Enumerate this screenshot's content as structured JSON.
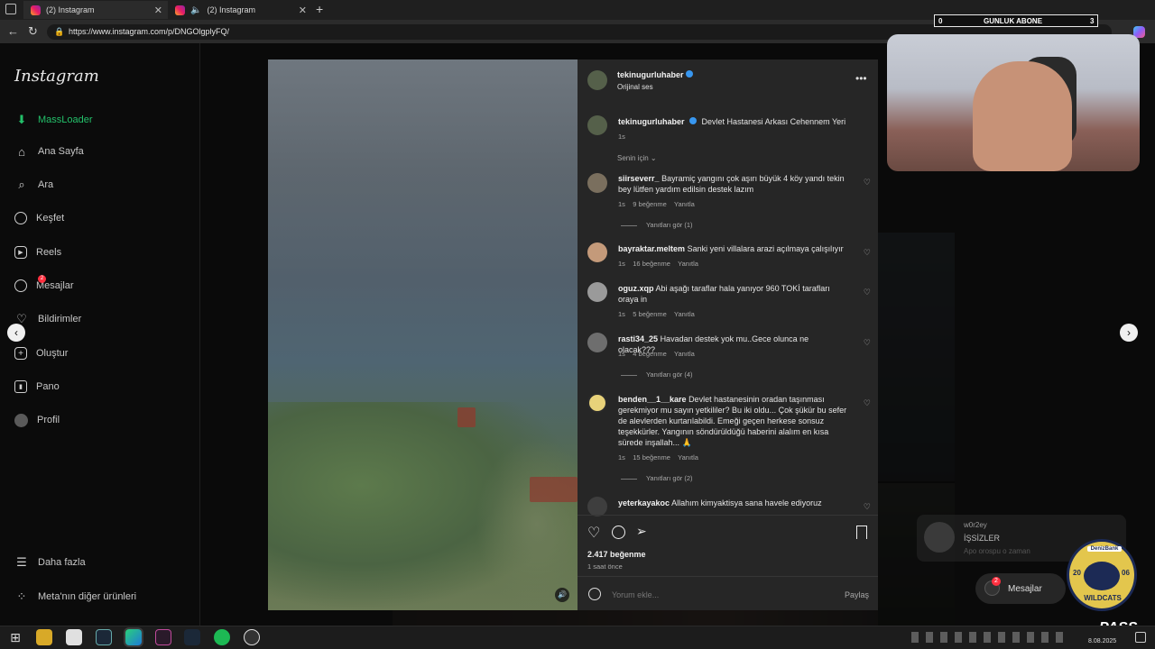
{
  "browser": {
    "tabs": [
      {
        "title": "(2) Instagram"
      },
      {
        "title": "(2) Instagram"
      }
    ],
    "new_tab": "+",
    "url": "https://www.instagram.com/p/DNGOlgplyFQ/"
  },
  "sidebar": {
    "logo": "Instagram",
    "items": [
      {
        "label": "MassLoader"
      },
      {
        "label": "Ana Sayfa"
      },
      {
        "label": "Ara"
      },
      {
        "label": "Keşfet"
      },
      {
        "label": "Reels"
      },
      {
        "label": "Mesajlar",
        "badge": "2"
      },
      {
        "label": "Bildirimler"
      },
      {
        "label": "Oluştur"
      },
      {
        "label": "Pano"
      },
      {
        "label": "Profil"
      }
    ],
    "more": "Daha fazla",
    "meta": "Meta'nın diğer ürünleri"
  },
  "post": {
    "author": "tekinugurluhaber",
    "audio": "Orijinal ses",
    "caption_author": "tekinugurluhaber",
    "caption": "Devlet Hastanesi Arkası Cehennem Yeri",
    "caption_time": "1s",
    "sort_label": "Senin için",
    "likes": "2.417 beğenme",
    "posted": "1 saat önce",
    "comment_placeholder": "Yorum ekle...",
    "share": "Paylaş"
  },
  "comments": [
    {
      "user": "siirseverr_",
      "text": "Bayramiç yangını çok aşırı büyük 4 köy yandı tekin bey lütfen yardım edilsin destek lazım",
      "time": "1s",
      "likes": "9 beğenme",
      "reply": "Yanıtla",
      "replies": "Yanıtları gör (1)"
    },
    {
      "user": "bayraktar.meltem",
      "text": "Sanki yeni villalara arazi açılmaya çalışılıyır",
      "time": "1s",
      "likes": "16 beğenme",
      "reply": "Yanıtla",
      "replies": ""
    },
    {
      "user": "oguz.xqp",
      "text": "Abi aşağı taraflar hala yanıyor 960 TOKİ tarafları oraya in",
      "time": "1s",
      "likes": "5 beğenme",
      "reply": "Yanıtla",
      "replies": ""
    },
    {
      "user": "rasti34_25",
      "text": "Havadan destek yok mu..Gece olunca ne olacak???",
      "time": "1s",
      "likes": "4 beğenme",
      "reply": "Yanıtla",
      "replies": "Yanıtları gör (4)"
    },
    {
      "user": "benden__1__kare",
      "text": "Devlet hastanesinin oradan taşınması gerekmiyor mu sayın yetkililer? Bu iki oldu... Çok şükür bu sefer de alevlerden kurtarılabildi. Emeği geçen herkese sonsuz teşekkürler. Yangının söndürüldüğü haberini alalım en kısa sürede inşallah... 🙏",
      "time": "1s",
      "likes": "15 beğenme",
      "reply": "Yanıtla",
      "replies": "Yanıtları gör (2)"
    },
    {
      "user": "yeterkayakoc",
      "text": "Allahım kimyaktisya sana havele ediyoruz",
      "time": "",
      "likes": "",
      "reply": "",
      "replies": ""
    }
  ],
  "overlay_msg": {
    "name": "w0r2ey",
    "title": "İŞSİZLER",
    "text": "Apo orospu o zaman"
  },
  "messages_chip": {
    "label": "Mesajlar",
    "badge": "2"
  },
  "stream": {
    "sub_left": "0",
    "sub_label": "GUNLUK ABONE",
    "sub_right": "3"
  },
  "badge_logo": {
    "top": "DenizBank",
    "year_left": "20",
    "year_right": "06",
    "name": "WILDCATS"
  },
  "pass_logo": "PASS",
  "clock": {
    "date": "8.08.2025"
  }
}
